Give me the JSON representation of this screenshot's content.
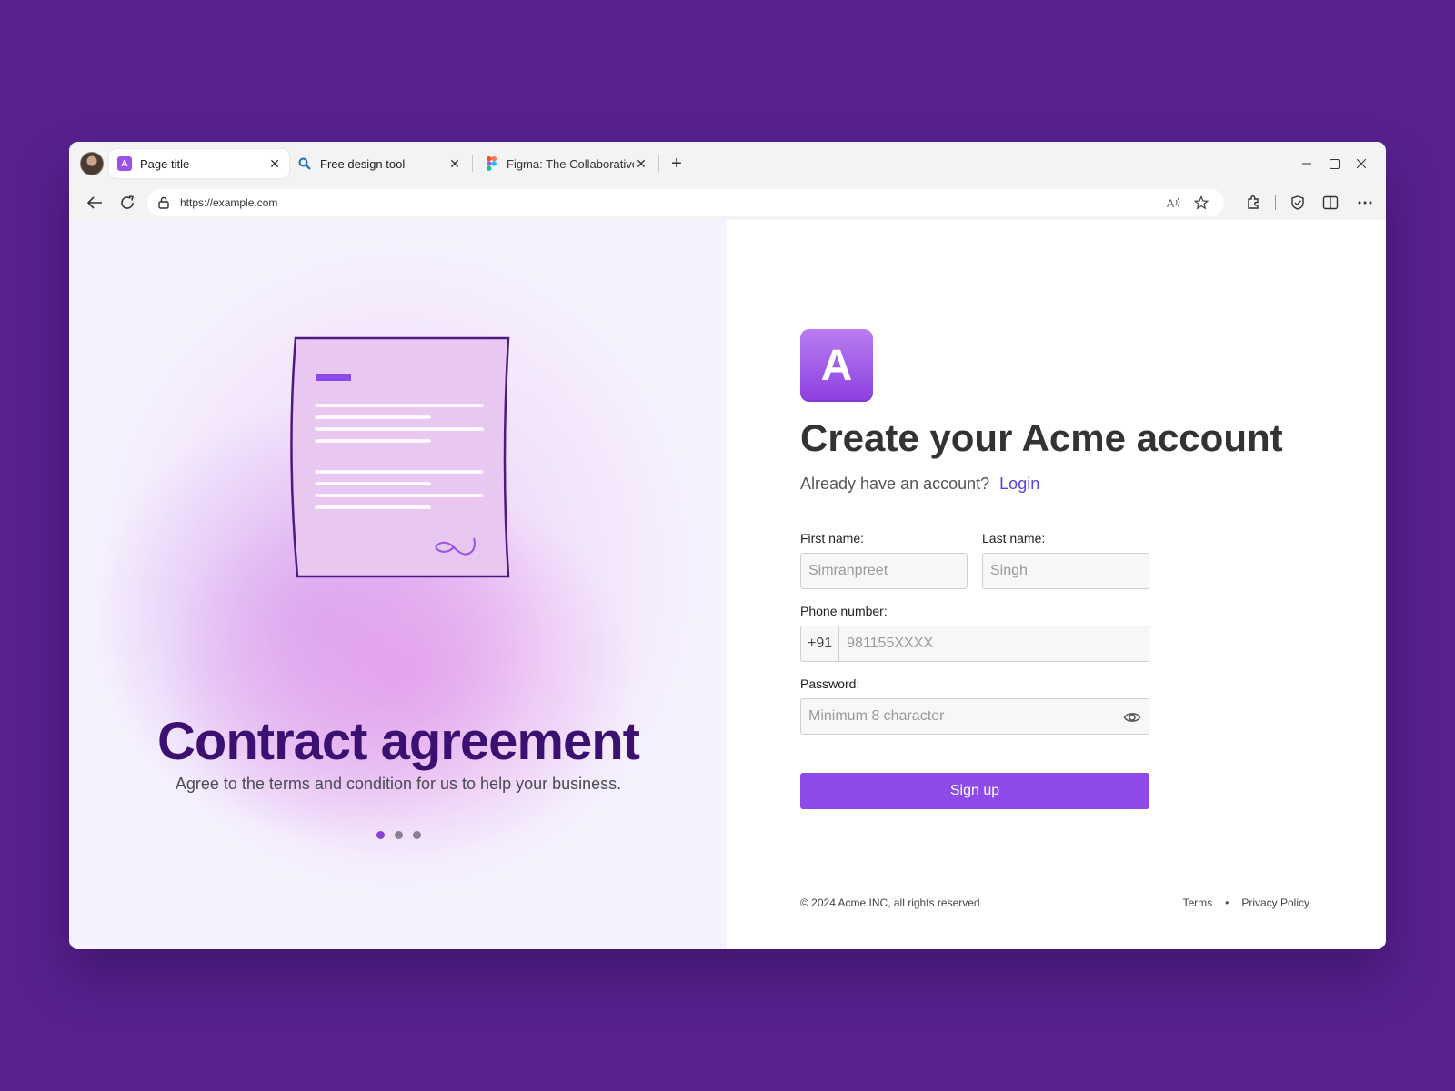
{
  "browser": {
    "tabs": [
      {
        "title": "Page title",
        "favicon": "acme-a-icon",
        "active": true
      },
      {
        "title": "Free design tool",
        "favicon": "search-icon",
        "active": false
      },
      {
        "title": "Figma: The Collaborative",
        "favicon": "figma-icon",
        "active": false
      }
    ],
    "favicon_letter": "A",
    "url": "https://example.com"
  },
  "left_panel": {
    "title": "Contract agreement",
    "subtitle": "Agree to the terms and condition for us to help your business.",
    "carousel_total": 3,
    "carousel_active": 1
  },
  "form": {
    "logo_letter": "A",
    "heading": "Create your Acme account",
    "login_prompt": "Already have an account?",
    "login_link": "Login",
    "first_name_label": "First name:",
    "first_name_placeholder": "Simranpreet",
    "last_name_label": "Last name:",
    "last_name_placeholder": "Singh",
    "phone_label": "Phone number:",
    "phone_prefix": "+91",
    "phone_placeholder": "981155XXXX",
    "password_label": "Password:",
    "password_placeholder": "Minimum 8 character",
    "submit_label": "Sign up"
  },
  "footer": {
    "copyright": "© 2024 Acme INC, all rights reserved",
    "terms": "Terms",
    "separator": "•",
    "privacy": "Privacy Policy"
  },
  "colors": {
    "page_background": "#58218e",
    "accent": "#8d4ae8",
    "link": "#5b3fe0",
    "left_title": "#3a1170"
  }
}
